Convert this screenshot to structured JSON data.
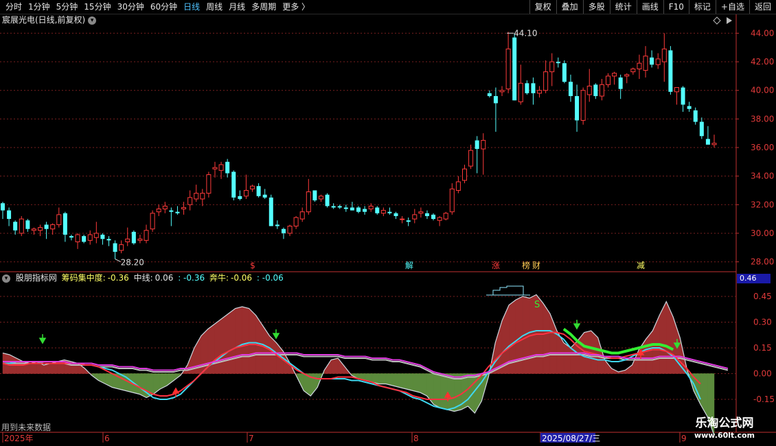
{
  "toolbar": {
    "periods": [
      "分时",
      "1分钟",
      "5分钟",
      "15分钟",
      "30分钟",
      "60分钟",
      "日线",
      "周线",
      "月线",
      "多周期",
      "更多 〉"
    ],
    "active_period": "日线",
    "tools": [
      "复权",
      "叠加",
      "多股",
      "统计",
      "画线",
      "F10",
      "标记",
      "+自选",
      "返回"
    ]
  },
  "stock": {
    "title": "宸展光电(日线,前复权)",
    "high_label": "44.10",
    "low_label": "28.20"
  },
  "indicator": {
    "name": "股朋指标网",
    "concentration_label": "筹码集中度:",
    "concentration_value": "-0.36",
    "midline_label": "中线:",
    "midline_value": "0.06",
    "extra_value": ": -0.36",
    "bull_label": "奔牛:",
    "bull_value": "-0.06",
    "bull_extra": ": -0.06",
    "current_value": "0.46"
  },
  "markers": [
    "$",
    "解",
    "涨",
    "榜",
    "财",
    "减"
  ],
  "chart_data": [
    {
      "type": "candlestick",
      "title": "宸展光电(日线,前复权)",
      "ylim": [
        27.5,
        44.5
      ],
      "y_ticks": [
        28,
        30,
        32,
        34,
        36,
        38,
        40,
        42,
        44
      ],
      "x_ticks": [
        "2025年",
        "6",
        "7",
        "8",
        "2025/08/27/三",
        "9"
      ],
      "up_color": "#ff3b3b",
      "down_color": "#54ffff",
      "candles": [
        [
          32.1,
          31.0,
          32.2,
          31.6
        ],
        [
          31.6,
          30.5,
          31.8,
          31.0
        ],
        [
          30.8,
          29.9,
          30.9,
          30.2
        ],
        [
          30.0,
          29.8,
          31.2,
          31.0
        ],
        [
          30.9,
          30.1,
          31.0,
          30.3
        ],
        [
          30.2,
          29.9,
          30.4,
          30.3
        ],
        [
          30.2,
          29.8,
          30.6,
          30.4
        ],
        [
          30.6,
          29.6,
          30.8,
          30.3
        ],
        [
          30.3,
          29.9,
          30.7,
          30.6
        ],
        [
          30.6,
          30.4,
          31.8,
          31.3
        ],
        [
          31.4,
          29.4,
          31.5,
          29.9
        ],
        [
          29.8,
          29.5,
          29.9,
          29.7
        ],
        [
          29.4,
          28.9,
          30.0,
          29.9
        ],
        [
          29.8,
          29.3,
          29.9,
          29.4
        ],
        [
          29.5,
          29.2,
          30.2,
          29.9
        ],
        [
          29.7,
          29.3,
          30.8,
          30.0
        ],
        [
          29.9,
          29.2,
          30.0,
          29.6
        ],
        [
          29.6,
          29.1,
          29.8,
          29.5
        ],
        [
          29.3,
          28.2,
          29.5,
          28.7
        ],
        [
          28.8,
          28.6,
          29.5,
          29.2
        ],
        [
          29.4,
          29.1,
          30.4,
          29.6
        ],
        [
          30.1,
          29.2,
          30.2,
          29.3
        ],
        [
          29.5,
          29.3,
          29.9,
          29.6
        ],
        [
          29.5,
          29.3,
          30.6,
          30.2
        ],
        [
          30.3,
          30.1,
          31.6,
          31.4
        ],
        [
          31.5,
          31.2,
          32.0,
          31.7
        ],
        [
          31.7,
          31.4,
          32.2,
          31.9
        ],
        [
          31.6,
          30.5,
          31.8,
          31.5
        ],
        [
          31.5,
          31.3,
          31.9,
          31.4
        ],
        [
          31.7,
          31.3,
          32.2,
          31.8
        ],
        [
          32.0,
          31.6,
          33.0,
          32.5
        ],
        [
          32.4,
          32.2,
          33.4,
          32.8
        ],
        [
          32.4,
          31.9,
          33.1,
          32.8
        ],
        [
          32.8,
          32.5,
          34.3,
          34.1
        ],
        [
          34.5,
          33.9,
          35.0,
          34.6
        ],
        [
          34.4,
          33.8,
          35.0,
          34.8
        ],
        [
          35.0,
          33.9,
          35.2,
          34.2
        ],
        [
          34.3,
          32.3,
          34.4,
          32.5
        ],
        [
          32.6,
          32.3,
          33.0,
          32.4
        ],
        [
          32.6,
          32.4,
          34.1,
          33.0
        ],
        [
          33.1,
          32.9,
          33.4,
          33.3
        ],
        [
          33.3,
          32.5,
          33.5,
          32.6
        ],
        [
          32.7,
          32.4,
          33.1,
          32.5
        ],
        [
          32.5,
          30.5,
          32.7,
          30.5
        ],
        [
          30.6,
          30.3,
          30.9,
          30.5
        ],
        [
          30.3,
          29.6,
          30.4,
          30.0
        ],
        [
          30.0,
          29.8,
          30.6,
          30.5
        ],
        [
          30.5,
          30.3,
          31.2,
          31.1
        ],
        [
          31.0,
          30.8,
          31.8,
          31.5
        ],
        [
          31.5,
          31.3,
          33.8,
          32.9
        ],
        [
          33.0,
          32.2,
          33.0,
          32.3
        ],
        [
          32.4,
          32.2,
          32.7,
          32.6
        ],
        [
          32.7,
          31.8,
          32.8,
          31.9
        ],
        [
          31.9,
          31.7,
          32.1,
          31.8
        ],
        [
          31.9,
          31.7,
          32.0,
          31.8
        ],
        [
          31.8,
          31.5,
          32.0,
          31.7
        ],
        [
          31.8,
          31.6,
          32.2,
          31.6
        ],
        [
          31.8,
          31.4,
          31.9,
          31.5
        ],
        [
          31.7,
          31.3,
          31.9,
          31.5
        ],
        [
          31.7,
          31.5,
          32.1,
          31.9
        ],
        [
          31.8,
          31.3,
          31.9,
          31.4
        ],
        [
          31.4,
          31.2,
          31.8,
          31.6
        ],
        [
          31.5,
          31.3,
          31.8,
          31.4
        ],
        [
          31.4,
          31.0,
          31.5,
          31.2
        ],
        [
          31.0,
          30.7,
          31.2,
          31.0
        ],
        [
          30.9,
          30.5,
          31.1,
          30.8
        ],
        [
          31.0,
          30.7,
          31.7,
          31.3
        ],
        [
          31.4,
          31.1,
          31.8,
          31.5
        ],
        [
          31.4,
          31.0,
          31.6,
          31.2
        ],
        [
          31.3,
          30.9,
          31.4,
          31.0
        ],
        [
          30.9,
          30.5,
          31.2,
          31.1
        ],
        [
          31.0,
          30.9,
          31.5,
          31.4
        ],
        [
          31.5,
          31.3,
          33.5,
          33.1
        ],
        [
          33.0,
          32.8,
          34.0,
          33.6
        ],
        [
          33.7,
          33.5,
          34.8,
          34.5
        ],
        [
          34.7,
          34.5,
          36.2,
          35.8
        ],
        [
          36.5,
          34.2,
          36.8,
          35.9
        ],
        [
          35.9,
          34.1,
          37.0,
          36.5
        ],
        [
          39.8,
          39.5,
          40.0,
          39.6
        ],
        [
          39.6,
          37.1,
          40.2,
          39.1
        ],
        [
          39.9,
          39.6,
          40.3,
          40.0
        ],
        [
          40.1,
          39.8,
          44.1,
          42.9
        ],
        [
          43.7,
          39.3,
          44.0,
          39.3
        ],
        [
          39.2,
          39.0,
          41.8,
          40.5
        ],
        [
          40.5,
          39.7,
          40.7,
          39.8
        ],
        [
          40.5,
          39.0,
          40.9,
          39.8
        ],
        [
          39.8,
          39.5,
          40.3,
          40.0
        ],
        [
          40.0,
          39.8,
          42.1,
          41.3
        ],
        [
          41.3,
          40.3,
          42.6,
          42.0
        ],
        [
          42.0,
          41.6,
          42.3,
          41.9
        ],
        [
          41.9,
          40.5,
          42.1,
          40.6
        ],
        [
          40.6,
          39.2,
          41.1,
          39.6
        ],
        [
          39.6,
          37.1,
          40.4,
          37.9
        ],
        [
          37.9,
          37.6,
          40.2,
          40.0
        ],
        [
          39.7,
          39.2,
          41.5,
          40.3
        ],
        [
          40.4,
          39.4,
          40.5,
          39.6
        ],
        [
          39.6,
          39.3,
          40.8,
          40.4
        ],
        [
          40.4,
          40.2,
          41.2,
          41.0
        ],
        [
          41.0,
          40.4,
          41.3,
          41.2
        ],
        [
          40.9,
          39.4,
          41.1,
          40.1
        ],
        [
          41.0,
          40.5,
          41.2,
          41.1
        ],
        [
          41.3,
          41.1,
          41.6,
          41.5
        ],
        [
          41.5,
          40.8,
          42.5,
          41.9
        ],
        [
          41.4,
          40.9,
          43.1,
          42.4
        ],
        [
          42.3,
          41.6,
          42.8,
          41.8
        ],
        [
          41.8,
          41.5,
          42.6,
          42.2
        ],
        [
          42.0,
          40.6,
          44.0,
          42.9
        ],
        [
          42.8,
          39.7,
          43.1,
          39.9
        ],
        [
          39.9,
          39.0,
          40.2,
          40.2
        ],
        [
          40.2,
          38.5,
          40.3,
          39.0
        ],
        [
          38.9,
          38.5,
          39.2,
          38.7
        ],
        [
          38.6,
          37.6,
          38.8,
          37.8
        ],
        [
          37.8,
          36.6,
          38.1,
          36.8
        ],
        [
          36.6,
          36.3,
          37.5,
          36.2
        ],
        [
          36.2,
          36.0,
          36.9,
          36.3
        ]
      ]
    },
    {
      "type": "area",
      "title": "股朋指标网",
      "ylim": [
        -0.27,
        0.53
      ],
      "y_ticks": [
        -0.15,
        0.0,
        0.15,
        0.3,
        0.45
      ],
      "series": [
        {
          "name": "筹码集中度",
          "values": [
            0.12,
            0.11,
            0.09,
            0.07,
            0.06,
            0.07,
            0.05,
            0.06,
            0.07,
            0.08,
            0.07,
            0.06,
            0.03,
            -0.01,
            -0.04,
            -0.06,
            -0.08,
            -0.09,
            -0.1,
            -0.11,
            -0.12,
            -0.14,
            -0.12,
            -0.09,
            -0.07,
            -0.04,
            -0.01,
            0.05,
            0.15,
            0.22,
            0.26,
            0.29,
            0.32,
            0.35,
            0.38,
            0.39,
            0.38,
            0.34,
            0.28,
            0.22,
            0.18,
            0.13,
            0.06,
            -0.02,
            -0.1,
            -0.13,
            -0.08,
            0.02,
            0.08,
            0.09,
            0.04,
            -0.01,
            -0.03,
            -0.04,
            -0.05,
            -0.06,
            -0.06,
            -0.07,
            -0.08,
            -0.09,
            -0.1,
            -0.11,
            -0.13,
            -0.18,
            -0.2,
            -0.21,
            -0.22,
            -0.21,
            -0.19,
            -0.23,
            -0.16,
            -0.02,
            0.18,
            0.31,
            0.4,
            0.43,
            0.45,
            0.44,
            0.46,
            0.41,
            0.35,
            0.25,
            0.18,
            0.15,
            0.19,
            0.24,
            0.25,
            0.21,
            0.08,
            0.03,
            0.01,
            0.02,
            0.05,
            0.14,
            0.2,
            0.25,
            0.34,
            0.42,
            0.33,
            0.21,
            0.03,
            -0.1,
            -0.18,
            -0.25,
            -0.36
          ]
        },
        {
          "name": "中线",
          "values": [
            0.06,
            0.06,
            0.06,
            0.06,
            0.06,
            0.06,
            0.06,
            0.06,
            0.06,
            0.06,
            0.05,
            0.05,
            0.05,
            0.05,
            0.04,
            0.04,
            0.04,
            0.03,
            0.03,
            0.03,
            0.02,
            0.02,
            0.01,
            0.01,
            0.01,
            0.01,
            0.02,
            0.02,
            0.03,
            0.04,
            0.05,
            0.06,
            0.07,
            0.08,
            0.09,
            0.1,
            0.1,
            0.11,
            0.11,
            0.11,
            0.11,
            0.11,
            0.11,
            0.11,
            0.1,
            0.1,
            0.1,
            0.1,
            0.1,
            0.1,
            0.09,
            0.09,
            0.09,
            0.09,
            0.08,
            0.08,
            0.08,
            0.07,
            0.07,
            0.06,
            0.05,
            0.04,
            0.02,
            0.0,
            -0.01,
            -0.02,
            -0.03,
            -0.03,
            -0.02,
            -0.02,
            -0.01,
            0.0,
            0.02,
            0.04,
            0.06,
            0.07,
            0.08,
            0.09,
            0.1,
            0.1,
            0.11,
            0.11,
            0.11,
            0.11,
            0.11,
            0.11,
            0.1,
            0.1,
            0.09,
            0.09,
            0.09,
            0.08,
            0.08,
            0.08,
            0.08,
            0.08,
            0.09,
            0.09,
            0.09,
            0.09,
            0.08,
            0.07,
            0.06,
            0.05,
            0.04,
            0.03,
            0.02
          ]
        },
        {
          "name": "奔牛",
          "values": [
            0.06,
            0.05,
            0.05,
            0.05,
            0.06,
            0.06,
            0.06,
            0.06,
            0.06,
            0.06,
            0.06,
            0.06,
            0.05,
            0.05,
            0.04,
            0.02,
            0.0,
            -0.02,
            -0.04,
            -0.06,
            -0.08,
            -0.1,
            -0.12,
            -0.13,
            -0.13,
            -0.12,
            -0.1,
            -0.07,
            -0.04,
            0.0,
            0.04,
            0.08,
            0.11,
            0.13,
            0.15,
            0.16,
            0.17,
            0.17,
            0.16,
            0.14,
            0.11,
            0.08,
            0.05,
            0.02,
            0.0,
            -0.02,
            -0.03,
            -0.03,
            -0.03,
            -0.02,
            -0.02,
            -0.02,
            -0.03,
            -0.04,
            -0.05,
            -0.07,
            -0.08,
            -0.09,
            -0.1,
            -0.11,
            -0.13,
            -0.14,
            -0.15,
            -0.15,
            -0.15,
            -0.15,
            -0.14,
            -0.12,
            -0.09,
            -0.05,
            -0.01,
            0.04,
            0.08,
            0.12,
            0.15,
            0.18,
            0.2,
            0.22,
            0.23,
            0.23,
            0.24,
            0.24,
            0.23,
            0.2,
            0.16,
            0.13,
            0.12,
            0.11,
            0.1,
            0.09,
            0.09,
            0.1,
            0.11,
            0.12,
            0.13,
            0.14,
            0.14,
            0.13,
            0.11,
            0.07,
            0.03,
            -0.02,
            -0.06
          ]
        },
        {
          "name": "曲线4",
          "values": [
            0.06,
            0.06,
            0.07,
            0.07,
            0.07,
            0.07,
            0.06,
            0.06,
            0.06,
            0.06,
            0.06,
            0.06,
            0.05,
            0.05,
            0.04,
            0.03,
            0.02,
            0.0,
            -0.02,
            -0.05,
            -0.08,
            -0.11,
            -0.14,
            -0.15,
            -0.15,
            -0.14,
            -0.12,
            -0.08,
            -0.04,
            0.0,
            0.04,
            0.07,
            0.1,
            0.13,
            0.15,
            0.17,
            0.18,
            0.18,
            0.17,
            0.15,
            0.12,
            0.09,
            0.06,
            0.03,
            0.0,
            -0.02,
            -0.03,
            -0.03,
            -0.03,
            -0.03,
            -0.03,
            -0.04,
            -0.04,
            -0.05,
            -0.06,
            -0.07,
            -0.08,
            -0.09,
            -0.1,
            -0.12,
            -0.14,
            -0.15,
            -0.17,
            -0.19,
            -0.2,
            -0.21,
            -0.2,
            -0.18,
            -0.15,
            -0.1,
            -0.05,
            0.01,
            0.07,
            0.12,
            0.16,
            0.19,
            0.22,
            0.24,
            0.25,
            0.25,
            0.25,
            0.23,
            0.2,
            0.15,
            0.12,
            0.1,
            0.09,
            0.08,
            0.08,
            0.07,
            0.07,
            0.08,
            0.1,
            0.12,
            0.14,
            0.15,
            0.15,
            0.13,
            0.1,
            0.05,
            0.0,
            -0.06,
            -0.15
          ]
        }
      ]
    }
  ]
}
